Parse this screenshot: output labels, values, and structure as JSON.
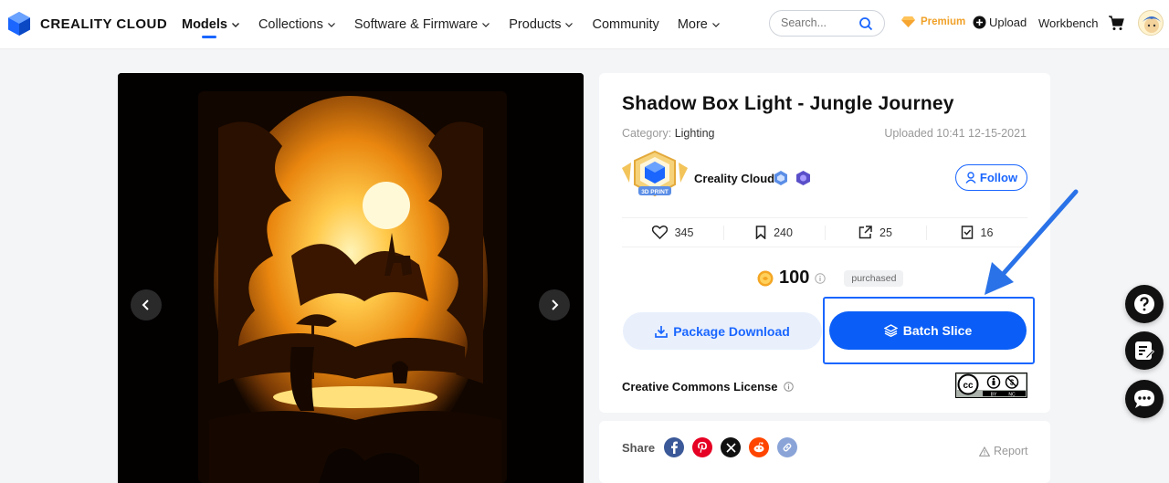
{
  "brand": {
    "name": "CREALITY CLOUD"
  },
  "nav": {
    "items": [
      {
        "label": "Models",
        "active": true,
        "dropdown": true
      },
      {
        "label": "Collections",
        "dropdown": true
      },
      {
        "label": "Software & Firmware",
        "dropdown": true
      },
      {
        "label": "Products",
        "dropdown": true
      },
      {
        "label": "Community",
        "dropdown": false
      },
      {
        "label": "More",
        "dropdown": true
      }
    ],
    "search_placeholder": "Search...",
    "premium_label": "Premium",
    "upload_label": "Upload",
    "workbench_label": "Workbench"
  },
  "model": {
    "title": "Shadow Box Light - Jungle Journey",
    "category_label": "Category:",
    "category": "Lighting",
    "uploaded": "Uploaded 10:41 12-15-2021",
    "author": "Creality Cloud",
    "badge_text": "3D PRINT",
    "follow_label": "Follow",
    "stats": {
      "likes": "345",
      "collections": "240",
      "shares": "25",
      "prints": "16"
    },
    "price": "100",
    "price_status": "purchased",
    "package_download_label": "Package Download",
    "batch_slice_label": "Batch Slice",
    "license_label": "Creative Commons License",
    "license_badge": {
      "cc": "cc",
      "by": "BY",
      "nc": "NC"
    }
  },
  "share": {
    "label": "Share",
    "networks": [
      "facebook",
      "pinterest",
      "x",
      "reddit",
      "copy-link"
    ],
    "report_label": "Report"
  },
  "colors": {
    "accent": "#1a66ff",
    "batch_button": "#0a5ef7",
    "premium": "#f0a128",
    "facebook": "#3b5998",
    "pinterest": "#e60023",
    "x": "#111111",
    "reddit": "#ff4500",
    "link": "#8aa4d8"
  }
}
